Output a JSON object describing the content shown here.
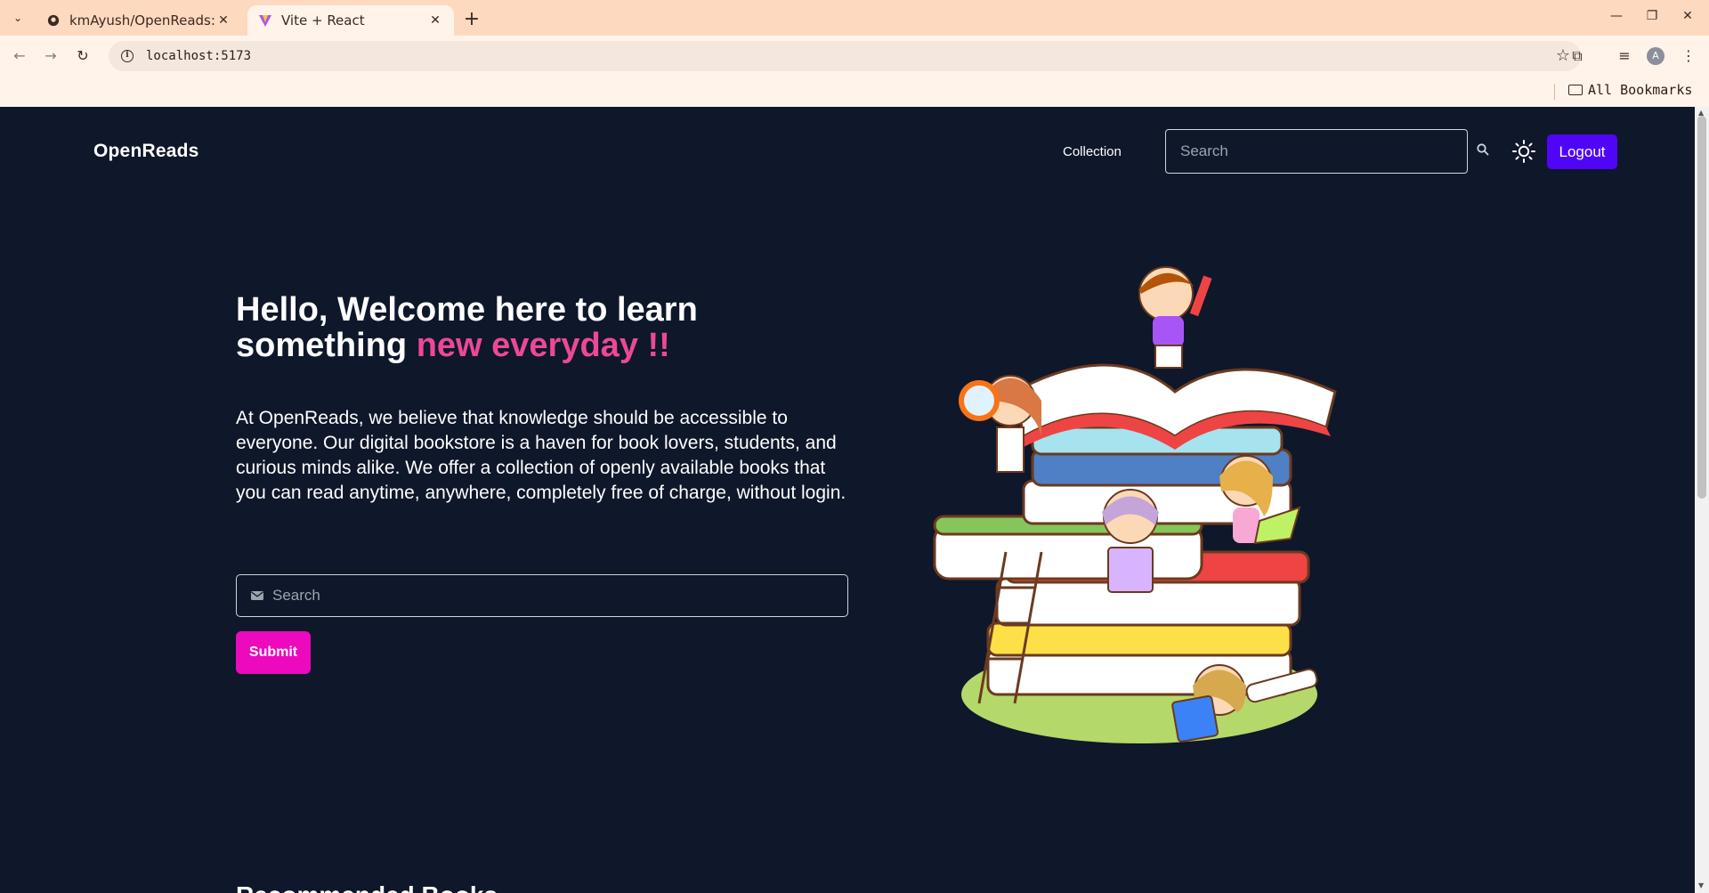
{
  "browser": {
    "tabs": [
      {
        "title": "kmAyush/OpenReads:",
        "active": false
      },
      {
        "title": "Vite + React",
        "active": true
      }
    ],
    "url": "localhost:5173",
    "bookmarks_label": "All Bookmarks",
    "profile_initial": "A"
  },
  "navbar": {
    "brand": "OpenReads",
    "collection_link": "Collection",
    "search_placeholder": "Search",
    "logout_label": "Logout"
  },
  "hero": {
    "title_part1": "Hello, Welcome here to learn something ",
    "title_accent": "new everyday !!",
    "description": "At OpenReads, we believe that knowledge should be accessible to everyone. Our digital bookstore is a haven for book lovers, students, and curious minds alike. We offer a collection of openly available books that you can read anytime, anywhere, completely free of charge, without login.",
    "email_placeholder": "Search",
    "submit_label": "Submit"
  },
  "next_section": {
    "heading": "Recommended Books"
  },
  "colors": {
    "page_bg": "#0f172a",
    "accent_pink": "#ec4899",
    "logout_bg": "#4f06f6",
    "submit_bg": "#ec09be",
    "tabstrip_bg": "#fdd9c0"
  }
}
